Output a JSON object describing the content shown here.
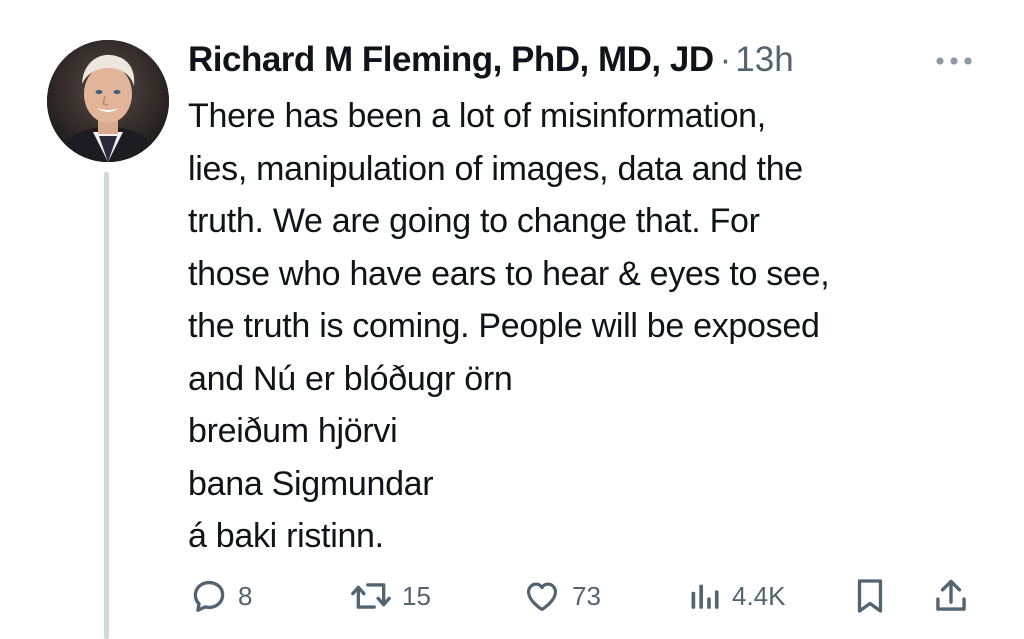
{
  "tweet": {
    "author": {
      "name": "Richard M Fleming, PhD, MD, JD",
      "avatar_icon": "profile-photo"
    },
    "separator": "·",
    "timestamp": "13h",
    "more_icon": "ellipsis-icon",
    "lines": [
      "There has been a lot of misinformation,",
      "lies, manipulation of images, data and the",
      "truth. We are going to change that. For",
      "those who have ears to hear & eyes to see,",
      "the truth is coming. People will be exposed",
      "and Nú er blóðugr örn",
      "breiðum hjörvi",
      "bana Sigmundar",
      "á baki ristinn."
    ],
    "actions": {
      "replies": "8",
      "reposts": "15",
      "likes": "73",
      "views": "4.4K"
    },
    "colors": {
      "text": "#0f1419",
      "secondary": "#536471",
      "thread_line": "#cfd9de"
    }
  }
}
